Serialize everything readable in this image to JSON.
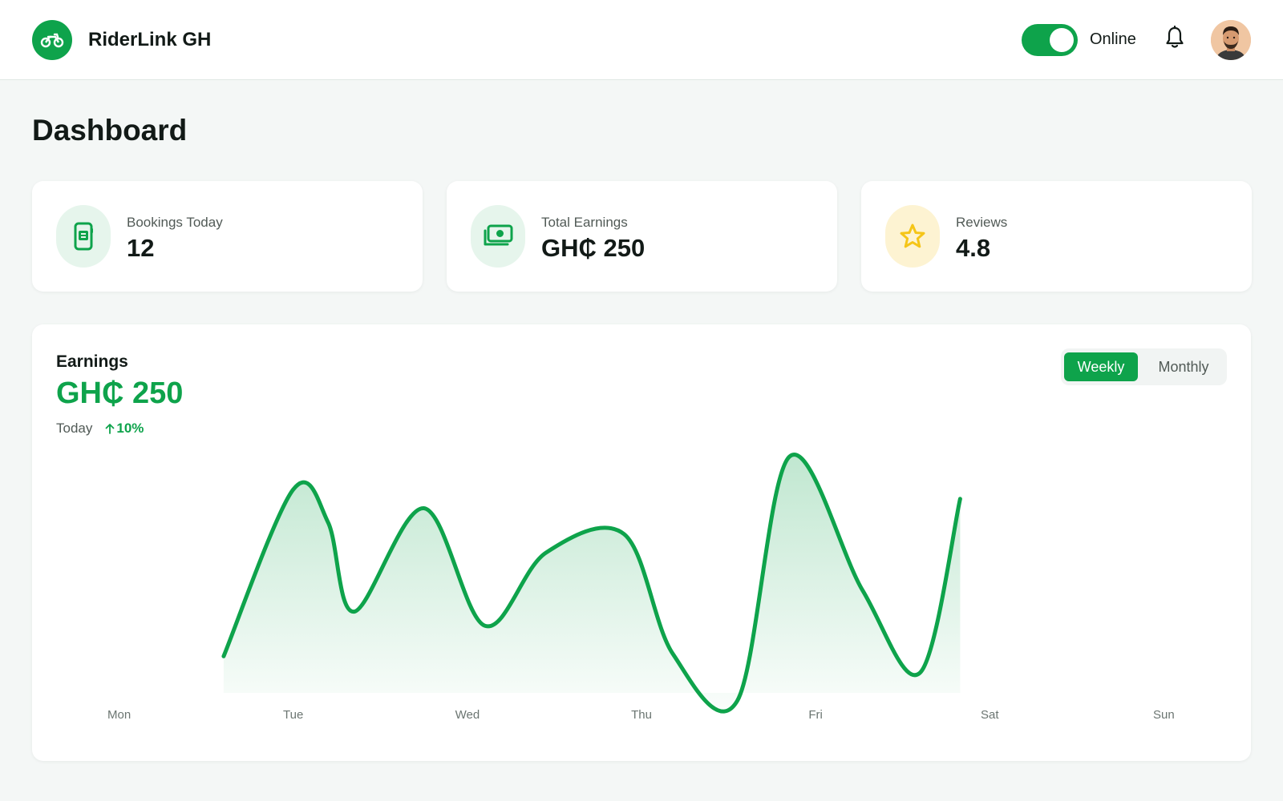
{
  "app": {
    "name": "RiderLink GH",
    "logo_icon": "motorbike-icon"
  },
  "header": {
    "status_label": "Online",
    "status_on": true
  },
  "page": {
    "title": "Dashboard"
  },
  "stats": [
    {
      "label": "Bookings Today",
      "value": "12",
      "icon": "phone-booking-icon"
    },
    {
      "label": "Total Earnings",
      "value": "GH₵ 250",
      "icon": "cash-icon"
    },
    {
      "label": "Reviews",
      "value": "4.8",
      "icon": "star-icon"
    }
  ],
  "earnings": {
    "title": "Earnings",
    "amount": "GH₵ 250",
    "period": "Today",
    "change": "10%",
    "tabs": {
      "weekly": "Weekly",
      "monthly": "Monthly",
      "selected": "Weekly"
    }
  },
  "colors": {
    "accent": "#0ea34b",
    "star": "#f5c518",
    "star_bg": "#fdf3d2",
    "icon_bg": "#e6f5ec"
  },
  "chart_data": {
    "type": "area",
    "categories": [
      "Mon",
      "Tue",
      "Wed",
      "Thu",
      "Fri",
      "Sat",
      "Sun"
    ],
    "x": [
      0.6,
      1.0,
      1.2,
      1.35,
      1.75,
      2.1,
      2.45,
      2.9,
      3.18,
      3.55,
      3.85,
      4.27,
      4.6,
      4.83,
      5.2,
      5.42
    ],
    "y": [
      0.17,
      0.88,
      0.74,
      0.36,
      0.8,
      0.3,
      0.61,
      0.69,
      0.18,
      -0.02,
      1.02,
      0.45,
      0.1,
      0.84,
      0.84,
      0.84
    ],
    "points_used": 14,
    "xlim": [
      -0.5,
      6.5
    ],
    "ylim": [
      -0.02,
      1.02
    ]
  }
}
